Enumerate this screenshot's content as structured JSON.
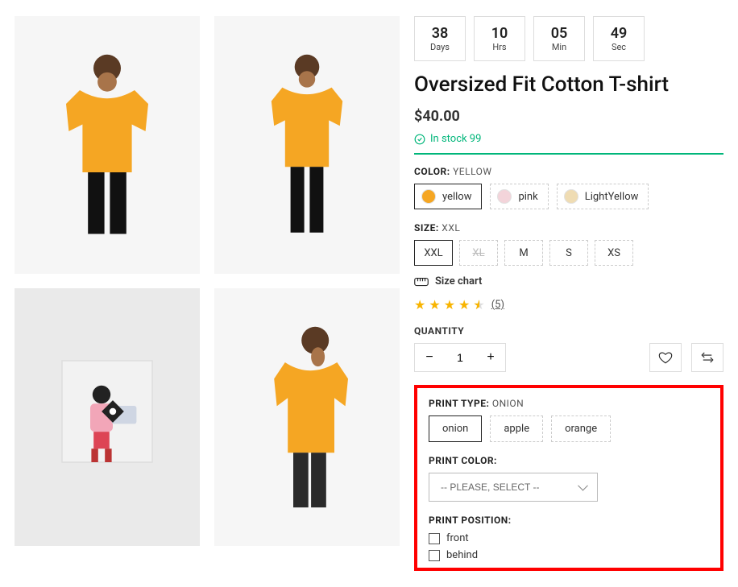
{
  "countdown": [
    {
      "value": "38",
      "label": "Days"
    },
    {
      "value": "10",
      "label": "Hrs"
    },
    {
      "value": "05",
      "label": "Min"
    },
    {
      "value": "49",
      "label": "Sec"
    }
  ],
  "title": "Oversized Fit Cotton T-shirt",
  "price": "$40.00",
  "stock_text": "In stock 99",
  "color_label": "COLOR:",
  "color_value": "YELLOW",
  "colors": [
    {
      "name": "yellow",
      "hex": "#f5a623",
      "selected": true
    },
    {
      "name": "pink",
      "hex": "#f3d4da",
      "selected": false
    },
    {
      "name": "LightYellow",
      "hex": "#efdcb3",
      "selected": false
    }
  ],
  "size_label": "SIZE:",
  "size_value": "XXL",
  "sizes": [
    {
      "label": "XXL",
      "selected": true,
      "disabled": false
    },
    {
      "label": "XL",
      "selected": false,
      "disabled": true
    },
    {
      "label": "M",
      "selected": false,
      "disabled": false
    },
    {
      "label": "S",
      "selected": false,
      "disabled": false
    },
    {
      "label": "XS",
      "selected": false,
      "disabled": false
    }
  ],
  "size_chart": "Size chart",
  "rating_count": "(5)",
  "qty_label": "QUANTITY",
  "qty_value": "1",
  "print_type_label": "PRINT TYPE:",
  "print_type_value": "ONION",
  "print_types": [
    {
      "label": "onion",
      "selected": true
    },
    {
      "label": "apple",
      "selected": false
    },
    {
      "label": "orange",
      "selected": false
    }
  ],
  "print_color_label": "PRINT COLOR:",
  "print_color_placeholder": "-- PLEASE, SELECT --",
  "print_position_label": "PRINT POSITION:",
  "print_positions": [
    {
      "label": "front"
    },
    {
      "label": "behind"
    }
  ],
  "tshirt_color": "#f5a623"
}
